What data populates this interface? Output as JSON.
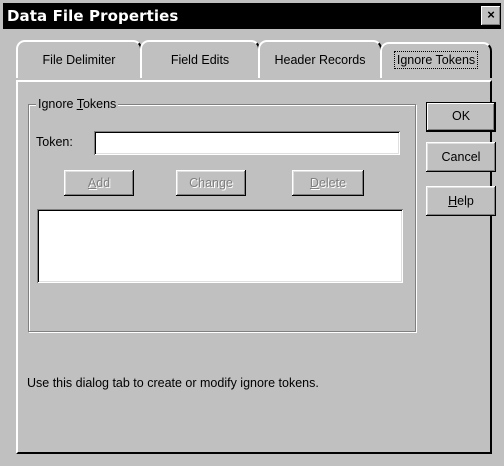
{
  "window": {
    "title": "Data File Properties",
    "close_label": "×"
  },
  "tabs": [
    {
      "label": "File Delimiter"
    },
    {
      "label": "Field Edits"
    },
    {
      "label": "Header Records"
    },
    {
      "label": "Ignore Tokens",
      "active": true
    }
  ],
  "group": {
    "label_prefix": "Ignore ",
    "label_access": "T",
    "label_suffix": "okens",
    "token_label": "Token:",
    "token_value": ""
  },
  "buttons": {
    "add": {
      "access": "A",
      "rest": "dd",
      "enabled": false
    },
    "change": {
      "label": "Change",
      "enabled": false
    },
    "delete": {
      "access": "D",
      "rest": "elete",
      "enabled": false
    }
  },
  "side_buttons": {
    "ok": "OK",
    "cancel": "Cancel",
    "help_access": "H",
    "help_rest": "elp"
  },
  "help_text": "Use this dialog tab to create or modify ignore tokens."
}
